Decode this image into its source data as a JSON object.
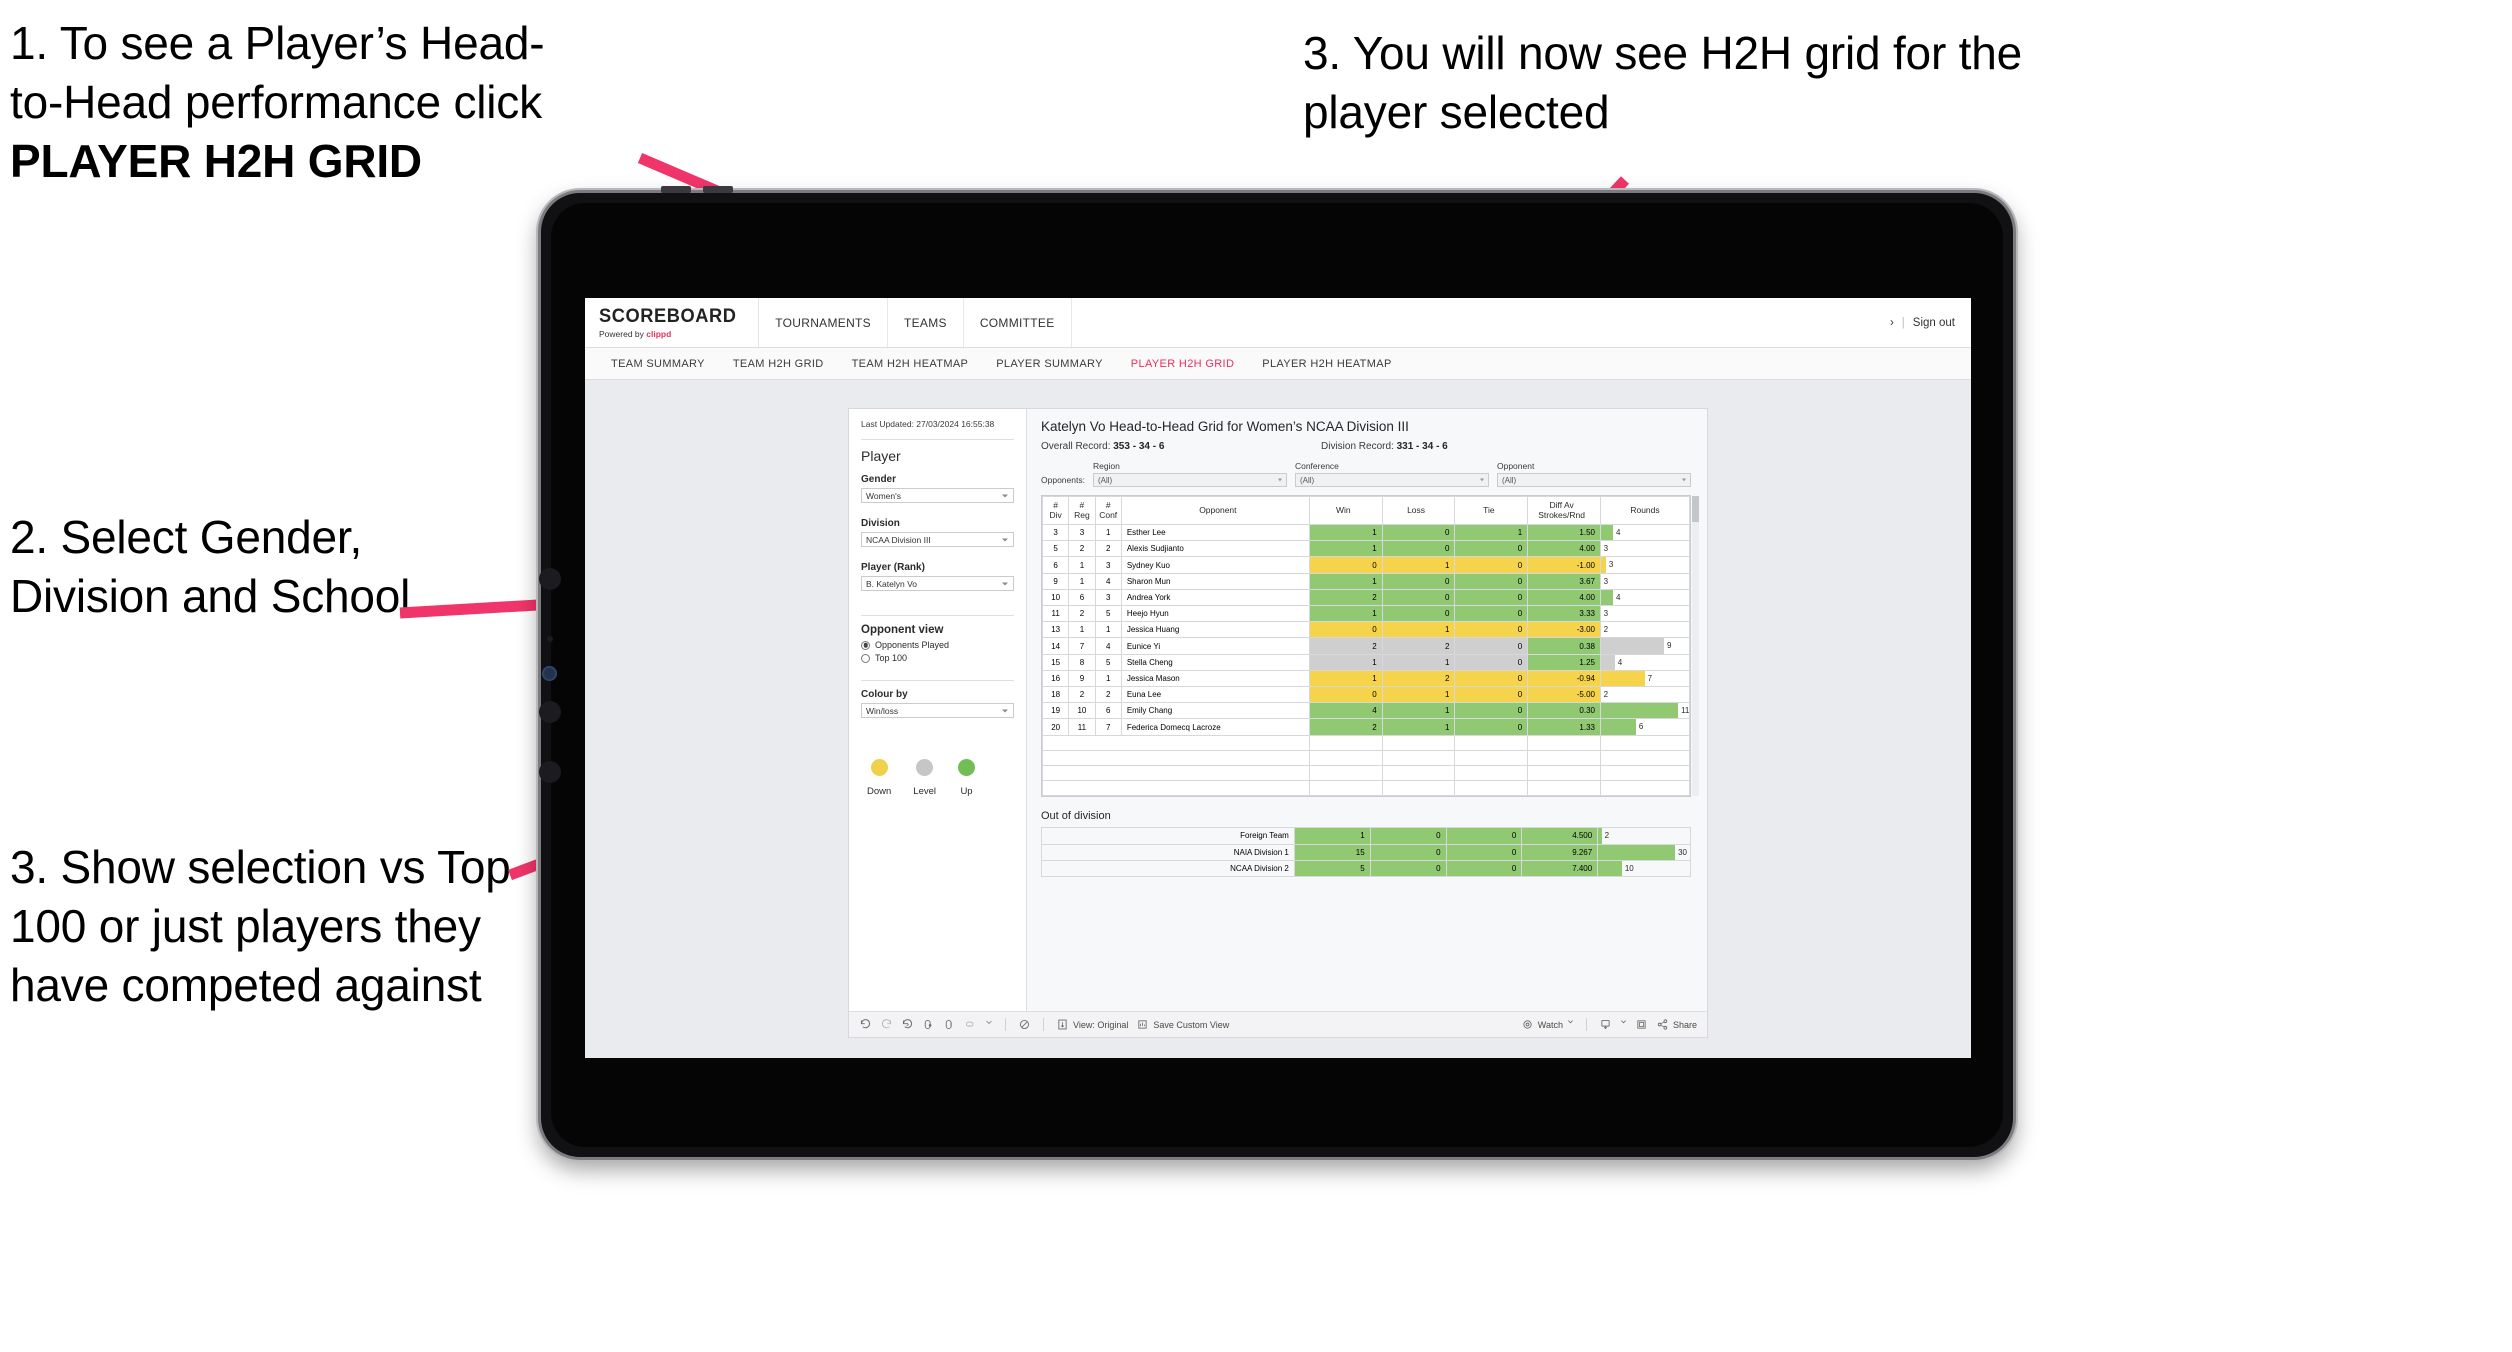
{
  "annotations": [
    {
      "id": "a1",
      "line1": "1. To see a Player’s Head-",
      "line2": "to-Head performance click",
      "line3": "PLAYER H2H GRID"
    },
    {
      "id": "a2",
      "text": "2. Select Gender, Division and School"
    },
    {
      "id": "a3",
      "text": "3. Show selection vs Top 100 or just players they have competed against"
    },
    {
      "id": "a4",
      "text": "3. You will now see H2H grid for the player selected"
    }
  ],
  "colors": {
    "accent": "#e8315e",
    "win": "#90c971",
    "down": "#f0d14c",
    "level": "#c6c6c6",
    "up": "#72bd56"
  },
  "app": {
    "brand": {
      "name": "SCOREBOARD",
      "powered_prefix": "Powered by ",
      "powered_brand": "clippd"
    },
    "nav": [
      {
        "label": "TOURNAMENTS"
      },
      {
        "label": "TEAMS"
      },
      {
        "label": "COMMITTEE"
      }
    ],
    "header_right": {
      "chevron": "›",
      "divider": "|",
      "sign_out": "Sign out"
    },
    "tabs": [
      {
        "label": "TEAM SUMMARY",
        "active": false
      },
      {
        "label": "TEAM H2H GRID",
        "active": false
      },
      {
        "label": "TEAM H2H HEATMAP",
        "active": false
      },
      {
        "label": "PLAYER SUMMARY",
        "active": false
      },
      {
        "label": "PLAYER H2H GRID",
        "active": true
      },
      {
        "label": "PLAYER H2H HEATMAP",
        "active": false
      }
    ]
  },
  "sidebar": {
    "last_updated": "Last Updated: 27/03/2024 16:55:38",
    "player_heading": "Player",
    "filters": [
      {
        "label": "Gender",
        "value": "Women's"
      },
      {
        "label": "Division",
        "value": "NCAA Division III"
      },
      {
        "label": "Player (Rank)",
        "value": "B. Katelyn Vo"
      }
    ],
    "opponent_view": {
      "heading": "Opponent view",
      "options": [
        {
          "label": "Opponents Played",
          "selected": true
        },
        {
          "label": "Top 100",
          "selected": false
        }
      ]
    },
    "colour_by": {
      "label": "Colour by",
      "value": "Win/loss"
    },
    "legend": [
      {
        "label": "Down",
        "color": "#f0d14c"
      },
      {
        "label": "Level",
        "color": "#c6c6c6"
      },
      {
        "label": "Up",
        "color": "#72bd56"
      }
    ]
  },
  "main": {
    "title": "Katelyn Vo Head-to-Head Grid for Women’s NCAA Division III",
    "overall_record_label": "Overall Record: ",
    "overall_record_value": "353 - 34 - 6",
    "division_record_label": "Division Record: ",
    "division_record_value": "331 - 34 - 6",
    "opponents_label": "Opponents:",
    "opponent_filters": [
      {
        "caption": "Region",
        "value": "(All)"
      },
      {
        "caption": "Conference",
        "value": "(All)"
      },
      {
        "caption": "Opponent",
        "value": "(All)"
      }
    ],
    "table_headers": {
      "div": "#\nDiv",
      "div_l1": "#",
      "div_l2": "Div",
      "reg_l1": "#",
      "reg_l2": "Reg",
      "conf_l1": "#",
      "conf_l2": "Conf",
      "opponent": "Opponent",
      "win": "Win",
      "loss": "Loss",
      "tie": "Tie",
      "diff_l1": "Diff Av",
      "diff_l2": "Strokes/Rnd",
      "rounds": "Rounds"
    },
    "out_of_division_title": "Out of division"
  },
  "chart_data": {
    "type": "table",
    "title": "Katelyn Vo Head-to-Head Grid for Women’s NCAA Division III",
    "columns": [
      "# Div",
      "# Reg",
      "# Conf",
      "Opponent",
      "Win",
      "Loss",
      "Tie",
      "Diff Av Strokes/Rnd",
      "Rounds"
    ],
    "rows": [
      {
        "div": "3",
        "reg": "3",
        "conf": "1",
        "opponent": "Esther Lee",
        "win": "1",
        "loss": "0",
        "tie": "1",
        "diff": "1.50",
        "rounds": "4",
        "state": "win",
        "bar_pct": 14
      },
      {
        "div": "5",
        "reg": "2",
        "conf": "2",
        "opponent": "Alexis Sudjianto",
        "win": "1",
        "loss": "0",
        "tie": "0",
        "diff": "4.00",
        "rounds": "3",
        "state": "win",
        "bar_pct": 0
      },
      {
        "div": "6",
        "reg": "1",
        "conf": "3",
        "opponent": "Sydney Kuo",
        "win": "0",
        "loss": "1",
        "tie": "0",
        "diff": "-1.00",
        "rounds": "3",
        "state": "lose",
        "bar_pct": 6
      },
      {
        "div": "9",
        "reg": "1",
        "conf": "4",
        "opponent": "Sharon Mun",
        "win": "1",
        "loss": "0",
        "tie": "0",
        "diff": "3.67",
        "rounds": "3",
        "state": "win",
        "bar_pct": 0
      },
      {
        "div": "10",
        "reg": "6",
        "conf": "3",
        "opponent": "Andrea York",
        "win": "2",
        "loss": "0",
        "tie": "0",
        "diff": "4.00",
        "rounds": "4",
        "state": "win",
        "bar_pct": 14
      },
      {
        "div": "11",
        "reg": "2",
        "conf": "5",
        "opponent": "Heejo Hyun",
        "win": "1",
        "loss": "0",
        "tie": "0",
        "diff": "3.33",
        "rounds": "3",
        "state": "win",
        "bar_pct": 0
      },
      {
        "div": "13",
        "reg": "1",
        "conf": "1",
        "opponent": "Jessica Huang",
        "win": "0",
        "loss": "1",
        "tie": "0",
        "diff": "-3.00",
        "rounds": "2",
        "state": "lose",
        "bar_pct": 0
      },
      {
        "div": "14",
        "reg": "7",
        "conf": "4",
        "opponent": "Eunice Yi",
        "win": "2",
        "loss": "2",
        "tie": "0",
        "diff": "0.38",
        "rounds": "9",
        "state": "tie",
        "bar_pct": 72
      },
      {
        "div": "15",
        "reg": "8",
        "conf": "5",
        "opponent": "Stella Cheng",
        "win": "1",
        "loss": "1",
        "tie": "0",
        "diff": "1.25",
        "rounds": "4",
        "state": "tie",
        "bar_pct": 16
      },
      {
        "div": "16",
        "reg": "9",
        "conf": "1",
        "opponent": "Jessica Mason",
        "win": "1",
        "loss": "2",
        "tie": "0",
        "diff": "-0.94",
        "rounds": "7",
        "state": "lose",
        "bar_pct": 50
      },
      {
        "div": "18",
        "reg": "2",
        "conf": "2",
        "opponent": "Euna Lee",
        "win": "0",
        "loss": "1",
        "tie": "0",
        "diff": "-5.00",
        "rounds": "2",
        "state": "lose",
        "bar_pct": 0
      },
      {
        "div": "19",
        "reg": "10",
        "conf": "6",
        "opponent": "Emily Chang",
        "win": "4",
        "loss": "1",
        "tie": "0",
        "diff": "0.30",
        "rounds": "11",
        "state": "win",
        "bar_pct": 88
      },
      {
        "div": "20",
        "reg": "11",
        "conf": "7",
        "opponent": "Federica Domecq Lacroze",
        "win": "2",
        "loss": "1",
        "tie": "0",
        "diff": "1.33",
        "rounds": "6",
        "state": "win",
        "bar_pct": 40
      }
    ],
    "out_of_division": [
      {
        "name": "Foreign Team",
        "win": "1",
        "loss": "0",
        "tie": "0",
        "diff": "4.500",
        "rounds": "2",
        "state": "win",
        "bar_pct": 4
      },
      {
        "name": "NAIA Division 1",
        "win": "15",
        "loss": "0",
        "tie": "0",
        "diff": "9.267",
        "rounds": "30",
        "state": "win",
        "bar_pct": 84
      },
      {
        "name": "NCAA Division 2",
        "win": "5",
        "loss": "0",
        "tie": "0",
        "diff": "7.400",
        "rounds": "10",
        "state": "win",
        "bar_pct": 26
      }
    ]
  },
  "toolbar": {
    "items": [
      {
        "name": "undo-icon",
        "label": ""
      },
      {
        "name": "redo-icon",
        "label": ""
      },
      {
        "name": "revert-icon",
        "label": ""
      },
      {
        "name": "refresh-data-icon",
        "label": ""
      },
      {
        "name": "pause-updates-icon",
        "label": ""
      },
      {
        "name": "highlight-icon",
        "label": ""
      }
    ],
    "view_original": "View: Original",
    "save_custom_view": "Save Custom View",
    "watch": "Watch",
    "share": "Share"
  }
}
